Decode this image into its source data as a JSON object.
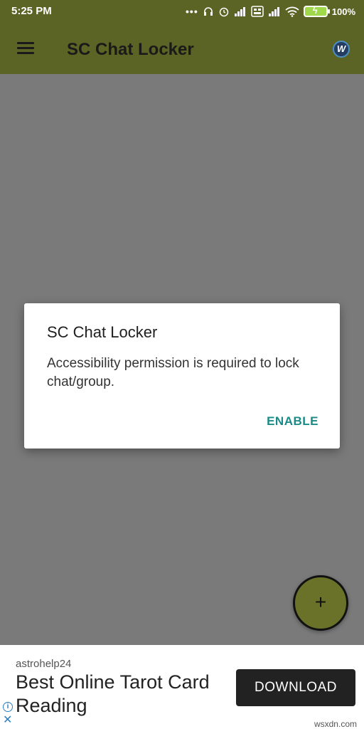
{
  "status_bar": {
    "time": "5:25 PM",
    "battery": "100%",
    "icons": [
      "more-dots-icon",
      "headphones-icon",
      "alarm-icon",
      "signal-icon",
      "volte-icon",
      "signal-icon",
      "wifi-icon",
      "battery-icon"
    ]
  },
  "app_bar": {
    "title": "SC Chat Locker",
    "menu_icon": "menu-icon",
    "badge_glyph": "W"
  },
  "dialog": {
    "title": "SC Chat Locker",
    "message": "Accessibility permission is required to lock chat/group.",
    "action": "ENABLE"
  },
  "fab": {
    "glyph": "+"
  },
  "ad": {
    "advertiser": "astrohelp24",
    "headline": "Best Online Tarot Card Reading",
    "button": "DOWNLOAD",
    "info_glyph": "i",
    "close_glyph": "✕"
  },
  "watermark": "wsxdn.com",
  "colors": {
    "app_bar": "#5b6424",
    "scrim": "#7a7a7a",
    "accent": "#1a8a86",
    "fab": "#6a7229"
  }
}
